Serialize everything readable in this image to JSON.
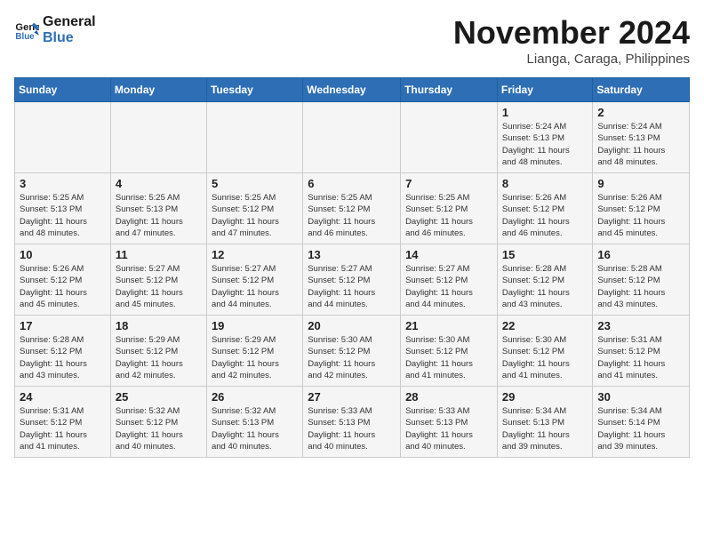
{
  "logo": {
    "line1": "General",
    "line2": "Blue"
  },
  "title": "November 2024",
  "location": "Lianga, Caraga, Philippines",
  "days_of_week": [
    "Sunday",
    "Monday",
    "Tuesday",
    "Wednesday",
    "Thursday",
    "Friday",
    "Saturday"
  ],
  "weeks": [
    [
      {
        "day": "",
        "info": ""
      },
      {
        "day": "",
        "info": ""
      },
      {
        "day": "",
        "info": ""
      },
      {
        "day": "",
        "info": ""
      },
      {
        "day": "",
        "info": ""
      },
      {
        "day": "1",
        "info": "Sunrise: 5:24 AM\nSunset: 5:13 PM\nDaylight: 11 hours\nand 48 minutes."
      },
      {
        "day": "2",
        "info": "Sunrise: 5:24 AM\nSunset: 5:13 PM\nDaylight: 11 hours\nand 48 minutes."
      }
    ],
    [
      {
        "day": "3",
        "info": "Sunrise: 5:25 AM\nSunset: 5:13 PM\nDaylight: 11 hours\nand 48 minutes."
      },
      {
        "day": "4",
        "info": "Sunrise: 5:25 AM\nSunset: 5:13 PM\nDaylight: 11 hours\nand 47 minutes."
      },
      {
        "day": "5",
        "info": "Sunrise: 5:25 AM\nSunset: 5:12 PM\nDaylight: 11 hours\nand 47 minutes."
      },
      {
        "day": "6",
        "info": "Sunrise: 5:25 AM\nSunset: 5:12 PM\nDaylight: 11 hours\nand 46 minutes."
      },
      {
        "day": "7",
        "info": "Sunrise: 5:25 AM\nSunset: 5:12 PM\nDaylight: 11 hours\nand 46 minutes."
      },
      {
        "day": "8",
        "info": "Sunrise: 5:26 AM\nSunset: 5:12 PM\nDaylight: 11 hours\nand 46 minutes."
      },
      {
        "day": "9",
        "info": "Sunrise: 5:26 AM\nSunset: 5:12 PM\nDaylight: 11 hours\nand 45 minutes."
      }
    ],
    [
      {
        "day": "10",
        "info": "Sunrise: 5:26 AM\nSunset: 5:12 PM\nDaylight: 11 hours\nand 45 minutes."
      },
      {
        "day": "11",
        "info": "Sunrise: 5:27 AM\nSunset: 5:12 PM\nDaylight: 11 hours\nand 45 minutes."
      },
      {
        "day": "12",
        "info": "Sunrise: 5:27 AM\nSunset: 5:12 PM\nDaylight: 11 hours\nand 44 minutes."
      },
      {
        "day": "13",
        "info": "Sunrise: 5:27 AM\nSunset: 5:12 PM\nDaylight: 11 hours\nand 44 minutes."
      },
      {
        "day": "14",
        "info": "Sunrise: 5:27 AM\nSunset: 5:12 PM\nDaylight: 11 hours\nand 44 minutes."
      },
      {
        "day": "15",
        "info": "Sunrise: 5:28 AM\nSunset: 5:12 PM\nDaylight: 11 hours\nand 43 minutes."
      },
      {
        "day": "16",
        "info": "Sunrise: 5:28 AM\nSunset: 5:12 PM\nDaylight: 11 hours\nand 43 minutes."
      }
    ],
    [
      {
        "day": "17",
        "info": "Sunrise: 5:28 AM\nSunset: 5:12 PM\nDaylight: 11 hours\nand 43 minutes."
      },
      {
        "day": "18",
        "info": "Sunrise: 5:29 AM\nSunset: 5:12 PM\nDaylight: 11 hours\nand 42 minutes."
      },
      {
        "day": "19",
        "info": "Sunrise: 5:29 AM\nSunset: 5:12 PM\nDaylight: 11 hours\nand 42 minutes."
      },
      {
        "day": "20",
        "info": "Sunrise: 5:30 AM\nSunset: 5:12 PM\nDaylight: 11 hours\nand 42 minutes."
      },
      {
        "day": "21",
        "info": "Sunrise: 5:30 AM\nSunset: 5:12 PM\nDaylight: 11 hours\nand 41 minutes."
      },
      {
        "day": "22",
        "info": "Sunrise: 5:30 AM\nSunset: 5:12 PM\nDaylight: 11 hours\nand 41 minutes."
      },
      {
        "day": "23",
        "info": "Sunrise: 5:31 AM\nSunset: 5:12 PM\nDaylight: 11 hours\nand 41 minutes."
      }
    ],
    [
      {
        "day": "24",
        "info": "Sunrise: 5:31 AM\nSunset: 5:12 PM\nDaylight: 11 hours\nand 41 minutes."
      },
      {
        "day": "25",
        "info": "Sunrise: 5:32 AM\nSunset: 5:12 PM\nDaylight: 11 hours\nand 40 minutes."
      },
      {
        "day": "26",
        "info": "Sunrise: 5:32 AM\nSunset: 5:13 PM\nDaylight: 11 hours\nand 40 minutes."
      },
      {
        "day": "27",
        "info": "Sunrise: 5:33 AM\nSunset: 5:13 PM\nDaylight: 11 hours\nand 40 minutes."
      },
      {
        "day": "28",
        "info": "Sunrise: 5:33 AM\nSunset: 5:13 PM\nDaylight: 11 hours\nand 40 minutes."
      },
      {
        "day": "29",
        "info": "Sunrise: 5:34 AM\nSunset: 5:13 PM\nDaylight: 11 hours\nand 39 minutes."
      },
      {
        "day": "30",
        "info": "Sunrise: 5:34 AM\nSunset: 5:14 PM\nDaylight: 11 hours\nand 39 minutes."
      }
    ]
  ]
}
